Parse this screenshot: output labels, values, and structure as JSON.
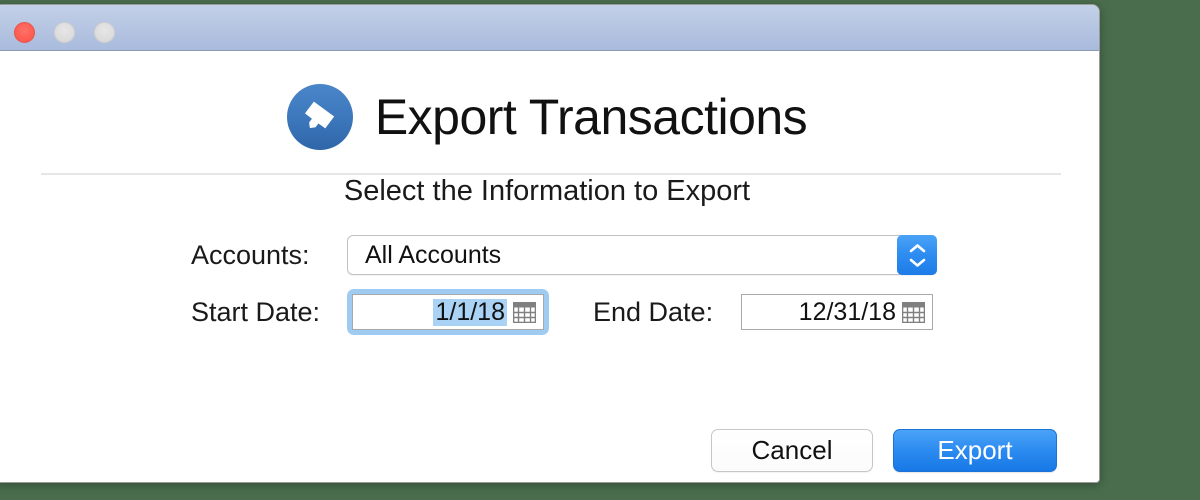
{
  "window": {
    "titlebar": {
      "close_label": "close",
      "minimize_label": "minimize",
      "zoom_label": "zoom"
    }
  },
  "header": {
    "icon": "export-arrow-icon",
    "title": "Export Transactions"
  },
  "subtitle": "Select the Information to Export",
  "form": {
    "accounts": {
      "label": "Accounts:",
      "selected": "All Accounts",
      "stepper_icon": "up-down-chevron-icon"
    },
    "start_date": {
      "label": "Start Date:",
      "value": "1/1/18",
      "calendar_icon": "calendar-icon",
      "focused": true,
      "selected_text": true
    },
    "end_date": {
      "label": "End Date:",
      "value": "12/31/18",
      "calendar_icon": "calendar-icon",
      "focused": false,
      "selected_text": false
    }
  },
  "buttons": {
    "cancel": "Cancel",
    "export": "Export"
  },
  "colors": {
    "desktop_background": "#4a6e4d",
    "titlebar_top": "#c3d0e8",
    "titlebar_bottom": "#a9bbdd",
    "close_button": "#fd5d52",
    "inactive_button": "#dddddd",
    "accent_blue": "#2d8cf0",
    "icon_blue": "#3d78bd",
    "focus_ring": "#9fcbf2",
    "selection_highlight": "#a9d2f5",
    "divider": "#e6e6e6"
  }
}
